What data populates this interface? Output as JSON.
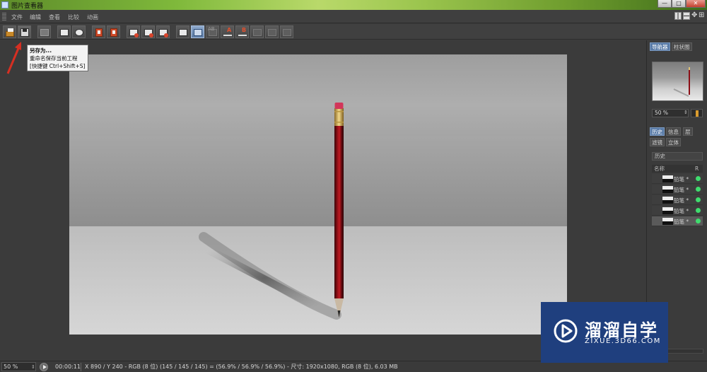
{
  "window": {
    "title": "图片查看器",
    "minimize": "—",
    "maximize": "□",
    "close": "✕"
  },
  "menu": [
    "文件",
    "编辑",
    "查看",
    "比较",
    "动画"
  ],
  "toolbar": {
    "buttons": [
      "open-icon",
      "save-as-icon",
      "gray-icon",
      "crop-icon",
      "person-icon",
      "red-doc-icon",
      "red-doc2-icon",
      "image-icon",
      "image2-icon",
      "image3-icon",
      "compare-a-icon",
      "compare-b-icon",
      "compare-c-icon",
      "letter-a-icon",
      "letter-b-icon",
      "dim1-icon",
      "dim2-icon",
      "dim3-icon"
    ],
    "letter_a": "A",
    "letter_b": "B",
    "ab_label": "AB"
  },
  "tooltip": {
    "title": "另存为...",
    "line2": "重命名保存当前工程",
    "line3": "[快捷键 Ctrl+Shift+S]"
  },
  "panel": {
    "nav_tabs": [
      "导航器",
      "柱状图"
    ],
    "zoom_value": "50 %",
    "bottom_tabs": [
      "历史",
      "信息",
      "层",
      "滤镜",
      "立体"
    ],
    "history_title": "历史",
    "col_name": "名称",
    "col_r": "R",
    "history_items": [
      "铅笔 *",
      "铅笔 *",
      "铅笔 *",
      "铅笔 *",
      "铅笔 *"
    ]
  },
  "status": {
    "zoom": "50 %",
    "time": "00:00:11",
    "info": "X 890 / Y 240 - RGB (8 位) (145 / 145 / 145) = (56.9% / 56.9% / 56.9%) - 尺寸: 1920x1080, RGB (8 位), 6.03 MB"
  },
  "watermark": {
    "brand": "溜溜自学",
    "url": "ZIXUE.3D66.COM"
  },
  "colors": {
    "accent": "#5a7ca8",
    "watermark_bg": "#1f3f7e",
    "history_dot": "#3fdc6e",
    "arrow": "#d62f22"
  }
}
